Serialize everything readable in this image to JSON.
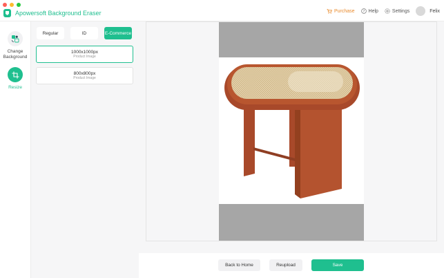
{
  "app": {
    "title": "Apowersoft Background Eraser",
    "brand_color": "#1fbf8f"
  },
  "topbar": {
    "purchase": "Purchase",
    "help": "Help",
    "settings": "Settings",
    "username": "Felix"
  },
  "rail": {
    "items": [
      {
        "label_line1": "Change",
        "label_line2": "Background",
        "icon": "change-background-icon",
        "active": false
      },
      {
        "label": "Resize",
        "icon": "crop-icon",
        "active": true
      }
    ]
  },
  "panel": {
    "tabs": [
      {
        "label": "Regular",
        "active": false
      },
      {
        "label": "ID",
        "active": false
      },
      {
        "label": "E-Commerce",
        "active": true
      }
    ],
    "sizes": [
      {
        "size": "1000x1000px",
        "type": "Product Image",
        "selected": true
      },
      {
        "size": "800x800px",
        "type": "Product Image",
        "selected": false
      }
    ]
  },
  "actions": {
    "back": "Back to Home",
    "reupload": "Reupload",
    "save": "Save"
  }
}
